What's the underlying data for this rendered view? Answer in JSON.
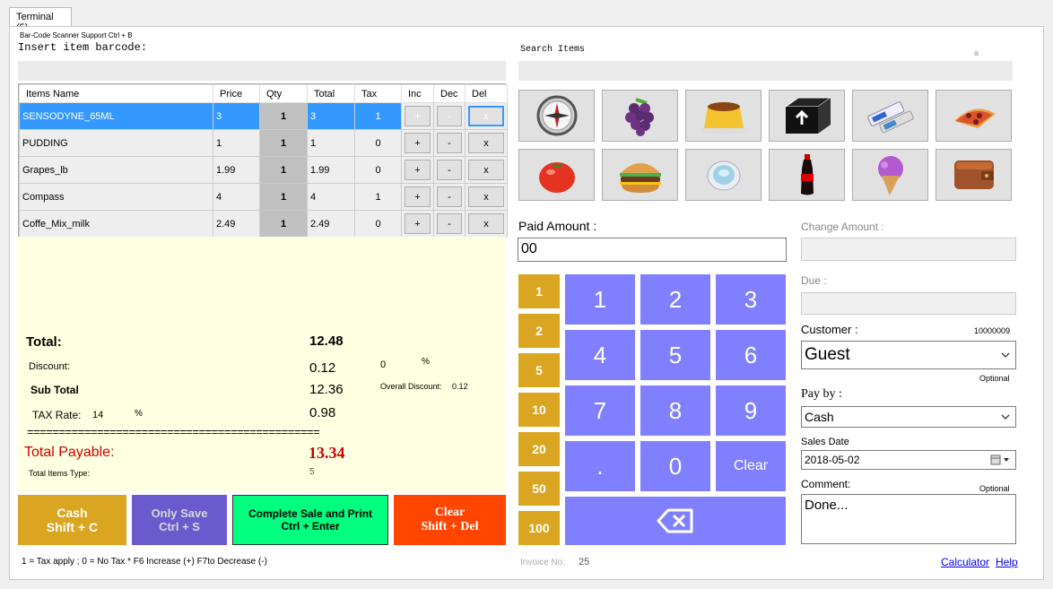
{
  "tab": {
    "label": "Terminal (5)"
  },
  "barcode": {
    "hint": "Bar-Code Scanner Support Ctrl + B",
    "label": "Insert item barcode:",
    "value": ""
  },
  "search": {
    "label": "Search Items",
    "hint": "a",
    "value": ""
  },
  "table": {
    "headers": [
      "Items Name",
      "Price",
      "Qty",
      "Total",
      "Tax",
      "Inc",
      "Dec",
      "Del"
    ],
    "rows": [
      {
        "name": "SENSODYNE_65ML",
        "price": "3",
        "qty": "1",
        "total": "3",
        "tax": "1",
        "inc": "+",
        "dec": "-",
        "del": "x"
      },
      {
        "name": "PUDDING",
        "price": "1",
        "qty": "1",
        "total": "1",
        "tax": "0",
        "inc": "+",
        "dec": "-",
        "del": "x"
      },
      {
        "name": "Grapes_lb",
        "price": "1.99",
        "qty": "1",
        "total": "1.99",
        "tax": "0",
        "inc": "+",
        "dec": "-",
        "del": "x"
      },
      {
        "name": "Compass",
        "price": "4",
        "qty": "1",
        "total": "4",
        "tax": "1",
        "inc": "+",
        "dec": "-",
        "del": "x"
      },
      {
        "name": "Coffe_Mix_milk",
        "price": "2.49",
        "qty": "1",
        "total": "2.49",
        "tax": "0",
        "inc": "+",
        "dec": "-",
        "del": "x"
      }
    ]
  },
  "summary": {
    "total_label": "Total:",
    "total_value": "12.48",
    "discount_label": "Discount:",
    "discount_value": "0.12",
    "discount_pct_value": "0",
    "discount_pct_sign": "%",
    "subtotal_label": "Sub Total",
    "subtotal_value": "12.36",
    "overall_discount_label": "Overall Discount:",
    "overall_discount_value": "0.12",
    "tax_rate_label": "TAX Rate:",
    "tax_rate_value": "14",
    "tax_rate_sign": "%",
    "tax_value": "0.98",
    "separator": "==============================================",
    "payable_label": "Total Payable:",
    "payable_value": "13.34",
    "items_type_label": "Total Items Type:",
    "items_type_value": "5"
  },
  "actions": {
    "cash": "Cash\nShift + C",
    "save": "Only Save\nCtrl + S",
    "complete": "Complete Sale and Print\nCtrl + Enter",
    "clear": "Clear\nShift + Del"
  },
  "footer": {
    "hint": "1 = Tax apply ; 0 =  No Tax  * F6 Increase (+)  F7to Decrease (-)",
    "invoice_label": "Invoice No:",
    "invoice_value": "25",
    "calculator": "Calculator",
    "help": "Help"
  },
  "products": [
    "compass-icon",
    "grapes-icon",
    "pudding-icon",
    "box-icon",
    "toothpaste-icon",
    "pizza-icon",
    "tomato-icon",
    "burger-icon",
    "coffee-cup-icon",
    "cola-bottle-icon",
    "ice-cream-icon",
    "wallet-icon"
  ],
  "paid": {
    "label": "Paid Amount :",
    "value": "00"
  },
  "quick_amounts": [
    "1",
    "2",
    "5",
    "10",
    "20",
    "50",
    "100"
  ],
  "keypad": {
    "k1": "1",
    "k2": "2",
    "k3": "3",
    "k4": "4",
    "k5": "5",
    "k6": "6",
    "k7": "7",
    "k8": "8",
    "k9": "9",
    "dot": ".",
    "k0": "0",
    "clear": "Clear"
  },
  "right": {
    "change_label": "Change Amount :",
    "change_value": "",
    "due_label": "Due :",
    "due_value": "",
    "customer_label": "Customer :",
    "customer_id": "10000009",
    "customer_value": "Guest",
    "customer_optional": "Optional",
    "payby_label": "Pay by :",
    "payby_value": "Cash",
    "date_label": "Sales Date",
    "date_value": "2018-05-02",
    "comment_label": "Comment:",
    "comment_optional": "Optional",
    "comment_value": "Done..."
  },
  "colors": {
    "selected": "#3399ff",
    "keypad": "#8080ff",
    "quick": "#daa520",
    "cash": "#daa520",
    "save": "#6a5acd",
    "complete": "#00ff7f",
    "clear": "#ff4500",
    "summary_bg": "#ffffe1",
    "payable": "#cc0000"
  }
}
